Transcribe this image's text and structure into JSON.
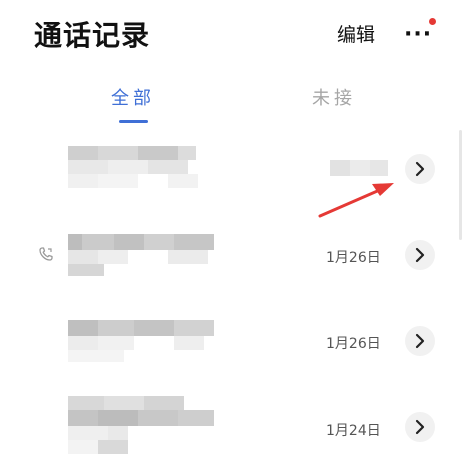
{
  "header": {
    "title": "通话记录",
    "edit_label": "编辑",
    "more_label": "···"
  },
  "tabs": [
    {
      "label": "全部",
      "selected": true
    },
    {
      "label": "未接",
      "selected": false
    }
  ],
  "records": [
    {
      "date": "",
      "date_blurred": true
    },
    {
      "date": "1月26日",
      "date_blurred": false
    },
    {
      "date": "1月26日",
      "date_blurred": false
    },
    {
      "date": "1月24日",
      "date_blurred": false
    }
  ],
  "colors": {
    "accent": "#3f6fd6",
    "notification_dot": "#e53935",
    "annotation_arrow": "#e53935"
  },
  "icons": {
    "more": "more-dots-icon",
    "detail": "chevron-right-icon",
    "call": "phone-icon",
    "annotation": "red-arrow-icon"
  }
}
